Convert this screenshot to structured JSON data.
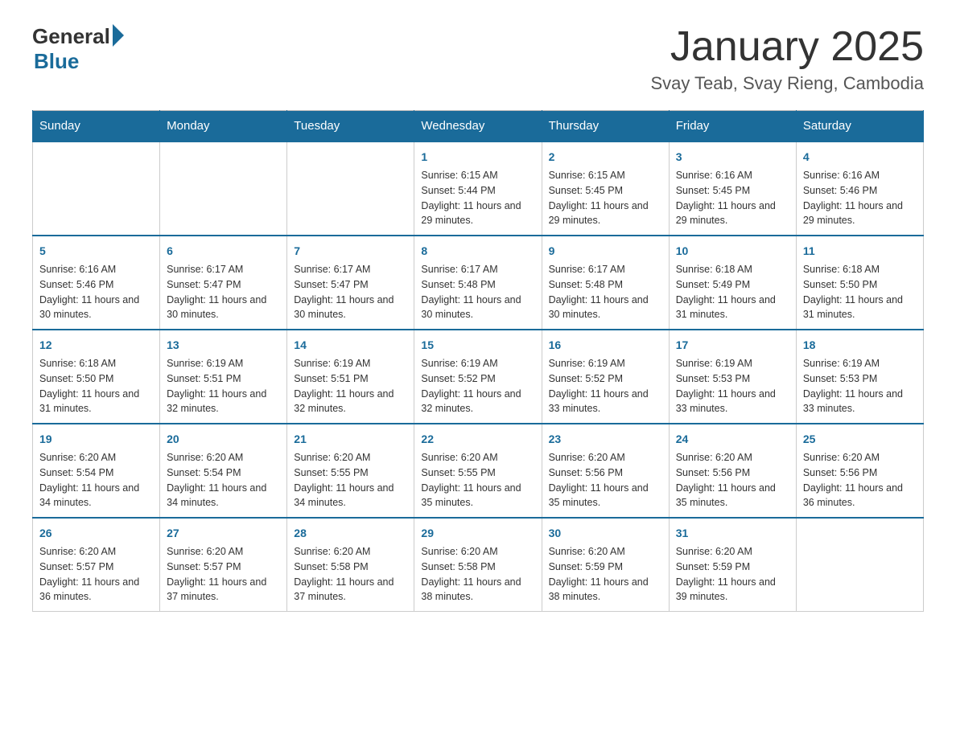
{
  "logo": {
    "general": "General",
    "blue": "Blue"
  },
  "header": {
    "title": "January 2025",
    "subtitle": "Svay Teab, Svay Rieng, Cambodia"
  },
  "days": [
    "Sunday",
    "Monday",
    "Tuesday",
    "Wednesday",
    "Thursday",
    "Friday",
    "Saturday"
  ],
  "weeks": [
    [
      {
        "day": "",
        "data": ""
      },
      {
        "day": "",
        "data": ""
      },
      {
        "day": "",
        "data": ""
      },
      {
        "day": "1",
        "data": "Sunrise: 6:15 AM\nSunset: 5:44 PM\nDaylight: 11 hours and 29 minutes."
      },
      {
        "day": "2",
        "data": "Sunrise: 6:15 AM\nSunset: 5:45 PM\nDaylight: 11 hours and 29 minutes."
      },
      {
        "day": "3",
        "data": "Sunrise: 6:16 AM\nSunset: 5:45 PM\nDaylight: 11 hours and 29 minutes."
      },
      {
        "day": "4",
        "data": "Sunrise: 6:16 AM\nSunset: 5:46 PM\nDaylight: 11 hours and 29 minutes."
      }
    ],
    [
      {
        "day": "5",
        "data": "Sunrise: 6:16 AM\nSunset: 5:46 PM\nDaylight: 11 hours and 30 minutes."
      },
      {
        "day": "6",
        "data": "Sunrise: 6:17 AM\nSunset: 5:47 PM\nDaylight: 11 hours and 30 minutes."
      },
      {
        "day": "7",
        "data": "Sunrise: 6:17 AM\nSunset: 5:47 PM\nDaylight: 11 hours and 30 minutes."
      },
      {
        "day": "8",
        "data": "Sunrise: 6:17 AM\nSunset: 5:48 PM\nDaylight: 11 hours and 30 minutes."
      },
      {
        "day": "9",
        "data": "Sunrise: 6:17 AM\nSunset: 5:48 PM\nDaylight: 11 hours and 30 minutes."
      },
      {
        "day": "10",
        "data": "Sunrise: 6:18 AM\nSunset: 5:49 PM\nDaylight: 11 hours and 31 minutes."
      },
      {
        "day": "11",
        "data": "Sunrise: 6:18 AM\nSunset: 5:50 PM\nDaylight: 11 hours and 31 minutes."
      }
    ],
    [
      {
        "day": "12",
        "data": "Sunrise: 6:18 AM\nSunset: 5:50 PM\nDaylight: 11 hours and 31 minutes."
      },
      {
        "day": "13",
        "data": "Sunrise: 6:19 AM\nSunset: 5:51 PM\nDaylight: 11 hours and 32 minutes."
      },
      {
        "day": "14",
        "data": "Sunrise: 6:19 AM\nSunset: 5:51 PM\nDaylight: 11 hours and 32 minutes."
      },
      {
        "day": "15",
        "data": "Sunrise: 6:19 AM\nSunset: 5:52 PM\nDaylight: 11 hours and 32 minutes."
      },
      {
        "day": "16",
        "data": "Sunrise: 6:19 AM\nSunset: 5:52 PM\nDaylight: 11 hours and 33 minutes."
      },
      {
        "day": "17",
        "data": "Sunrise: 6:19 AM\nSunset: 5:53 PM\nDaylight: 11 hours and 33 minutes."
      },
      {
        "day": "18",
        "data": "Sunrise: 6:19 AM\nSunset: 5:53 PM\nDaylight: 11 hours and 33 minutes."
      }
    ],
    [
      {
        "day": "19",
        "data": "Sunrise: 6:20 AM\nSunset: 5:54 PM\nDaylight: 11 hours and 34 minutes."
      },
      {
        "day": "20",
        "data": "Sunrise: 6:20 AM\nSunset: 5:54 PM\nDaylight: 11 hours and 34 minutes."
      },
      {
        "day": "21",
        "data": "Sunrise: 6:20 AM\nSunset: 5:55 PM\nDaylight: 11 hours and 34 minutes."
      },
      {
        "day": "22",
        "data": "Sunrise: 6:20 AM\nSunset: 5:55 PM\nDaylight: 11 hours and 35 minutes."
      },
      {
        "day": "23",
        "data": "Sunrise: 6:20 AM\nSunset: 5:56 PM\nDaylight: 11 hours and 35 minutes."
      },
      {
        "day": "24",
        "data": "Sunrise: 6:20 AM\nSunset: 5:56 PM\nDaylight: 11 hours and 35 minutes."
      },
      {
        "day": "25",
        "data": "Sunrise: 6:20 AM\nSunset: 5:56 PM\nDaylight: 11 hours and 36 minutes."
      }
    ],
    [
      {
        "day": "26",
        "data": "Sunrise: 6:20 AM\nSunset: 5:57 PM\nDaylight: 11 hours and 36 minutes."
      },
      {
        "day": "27",
        "data": "Sunrise: 6:20 AM\nSunset: 5:57 PM\nDaylight: 11 hours and 37 minutes."
      },
      {
        "day": "28",
        "data": "Sunrise: 6:20 AM\nSunset: 5:58 PM\nDaylight: 11 hours and 37 minutes."
      },
      {
        "day": "29",
        "data": "Sunrise: 6:20 AM\nSunset: 5:58 PM\nDaylight: 11 hours and 38 minutes."
      },
      {
        "day": "30",
        "data": "Sunrise: 6:20 AM\nSunset: 5:59 PM\nDaylight: 11 hours and 38 minutes."
      },
      {
        "day": "31",
        "data": "Sunrise: 6:20 AM\nSunset: 5:59 PM\nDaylight: 11 hours and 39 minutes."
      },
      {
        "day": "",
        "data": ""
      }
    ]
  ]
}
